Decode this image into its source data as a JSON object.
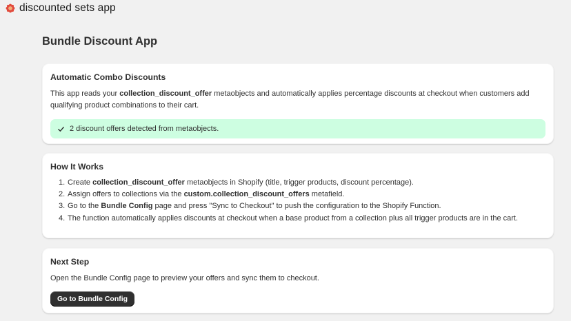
{
  "app": {
    "name": "discounted sets app",
    "logo_icon": "flower-logo-icon",
    "logo_color": "#e24a3b"
  },
  "page": {
    "title": "Bundle Discount App"
  },
  "auto_card": {
    "title": "Automatic Combo Discounts",
    "text_pre": "This app reads your ",
    "text_bold": "collection_discount_offer",
    "text_post": " metaobjects and automatically applies percentage discounts at checkout when customers add qualifying product combinations to their cart.",
    "banner_icon": "checkmark-icon",
    "banner_text": "2 discount offers detected from metaobjects.",
    "banner_color": "#cdfee1"
  },
  "how_card": {
    "title": "How It Works",
    "steps": [
      {
        "num": "1.",
        "pre": "Create ",
        "bold": "collection_discount_offer",
        "post": " metaobjects in Shopify (title, trigger products, discount percentage)."
      },
      {
        "num": "2.",
        "pre": "Assign offers to collections via the ",
        "bold": "custom.collection_discount_offers",
        "post": " metafield."
      },
      {
        "num": "3.",
        "pre": "Go to the ",
        "bold": "Bundle Config",
        "post": " page and press \"Sync to Checkout\" to push the configuration to the Shopify Function."
      },
      {
        "num": "4.",
        "pre": "The function automatically applies discounts at checkout when a base product from a collection plus all trigger products are in the cart.",
        "bold": "",
        "post": ""
      }
    ]
  },
  "next_card": {
    "title": "Next Step",
    "text": "Open the Bundle Config page to preview your offers and sync them to checkout.",
    "button_label": "Go to Bundle Config"
  }
}
